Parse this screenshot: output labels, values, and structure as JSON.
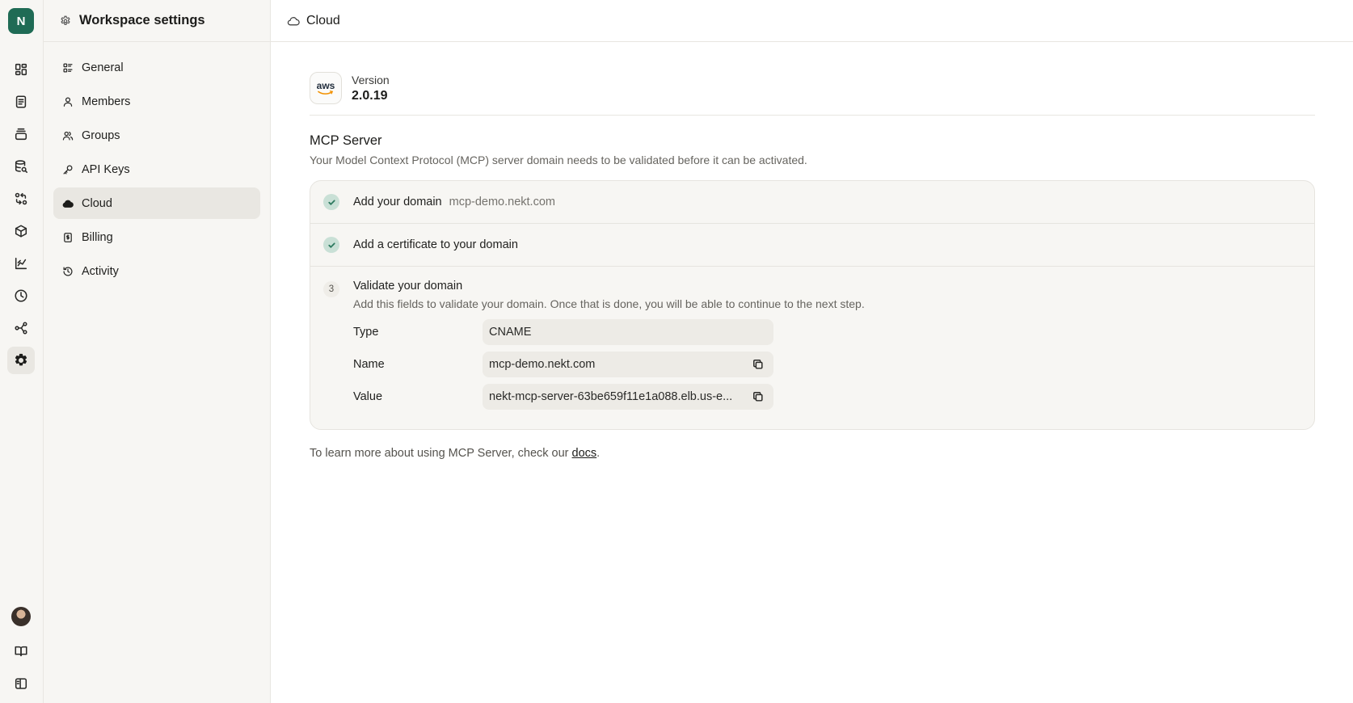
{
  "rail": {
    "workspace_initial": "N",
    "items": [
      {
        "icon": "dashboard-icon"
      },
      {
        "icon": "document-icon"
      },
      {
        "icon": "layers-icon"
      },
      {
        "icon": "database-search-icon"
      },
      {
        "icon": "transfer-icon"
      },
      {
        "icon": "package-icon"
      },
      {
        "icon": "chart-icon"
      },
      {
        "icon": "clock-icon"
      },
      {
        "icon": "share-icon"
      },
      {
        "icon": "gear-icon",
        "active": true
      }
    ],
    "bottom": [
      {
        "icon": "avatar"
      },
      {
        "icon": "book-icon"
      },
      {
        "icon": "sidebar-toggle-icon"
      }
    ]
  },
  "panel": {
    "title": "Workspace settings",
    "items": [
      {
        "label": "General",
        "icon": "sliders-icon"
      },
      {
        "label": "Members",
        "icon": "user-icon"
      },
      {
        "label": "Groups",
        "icon": "users-icon"
      },
      {
        "label": "API Keys",
        "icon": "key-icon"
      },
      {
        "label": "Cloud",
        "icon": "cloud-icon",
        "active": true
      },
      {
        "label": "Billing",
        "icon": "receipt-icon"
      },
      {
        "label": "Activity",
        "icon": "history-icon"
      }
    ]
  },
  "topbar": {
    "title": "Cloud",
    "icon": "cloud-icon"
  },
  "version": {
    "logo_text": "aws",
    "label": "Version",
    "value": "2.0.19"
  },
  "mcp": {
    "title": "MCP Server",
    "description": "Your Model Context Protocol (MCP) server domain needs to be validated before it can be activated.",
    "steps": [
      {
        "label": "Add your domain",
        "extra": "mcp-demo.nekt.com",
        "status": "done"
      },
      {
        "label": "Add a certificate to your domain",
        "extra": "",
        "status": "done"
      },
      {
        "number": "3",
        "label": "Validate your domain",
        "description": "Add this fields to validate your domain. Once that is done, you will be able to continue to the next step.",
        "status": "current",
        "fields": [
          {
            "label": "Type",
            "value": "CNAME"
          },
          {
            "label": "Name",
            "value": "mcp-demo.nekt.com"
          },
          {
            "label": "Value",
            "value": "nekt-mcp-server-63be659f11e1a088.elb.us-e..."
          }
        ]
      }
    ],
    "footer_prefix": "To learn more about using MCP Server, check our ",
    "footer_link": "docs",
    "footer_suffix": "."
  },
  "colors": {
    "brand": "#1f6b55",
    "check_bg": "#c9e0d6",
    "active_bg": "#e9e7e2"
  }
}
